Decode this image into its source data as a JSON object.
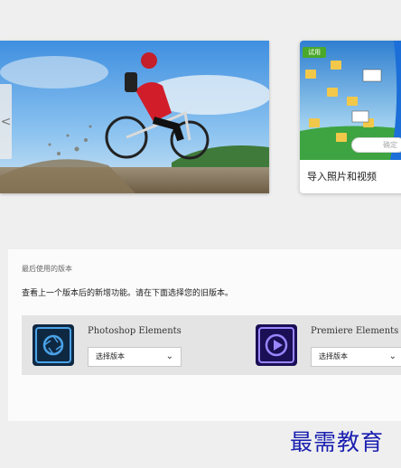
{
  "carousel": {
    "prev_arrow": "<",
    "side_card": {
      "badge": "试用",
      "label": "导入照片和视频",
      "thumb_icons": [
        "folder-icon",
        "folder-icon",
        "folder-icon",
        "folder-icon",
        "folder-icon",
        "folder-icon",
        "folder-icon",
        "image-icon",
        "image-icon"
      ]
    }
  },
  "recent": {
    "title": "最后使用的版本",
    "description": "查看上一个版本后的新增功能。请在下面选择您的旧版本。",
    "products": [
      {
        "name": "Photoshop Elements",
        "icon": "photoshop-elements-icon",
        "select_value": "选择版本",
        "icon_color": "#1e3a5c"
      },
      {
        "name": "Premiere Elements",
        "icon": "premiere-elements-icon",
        "select_value": "选择版本",
        "icon_color": "#2a1a63"
      }
    ],
    "confirm_label": "确定"
  },
  "watermark": "最需教育",
  "colors": {
    "accent_green": "#4aa82a",
    "watermark_blue": "#1a1fb0",
    "panel_gray": "#e4e4e4"
  }
}
